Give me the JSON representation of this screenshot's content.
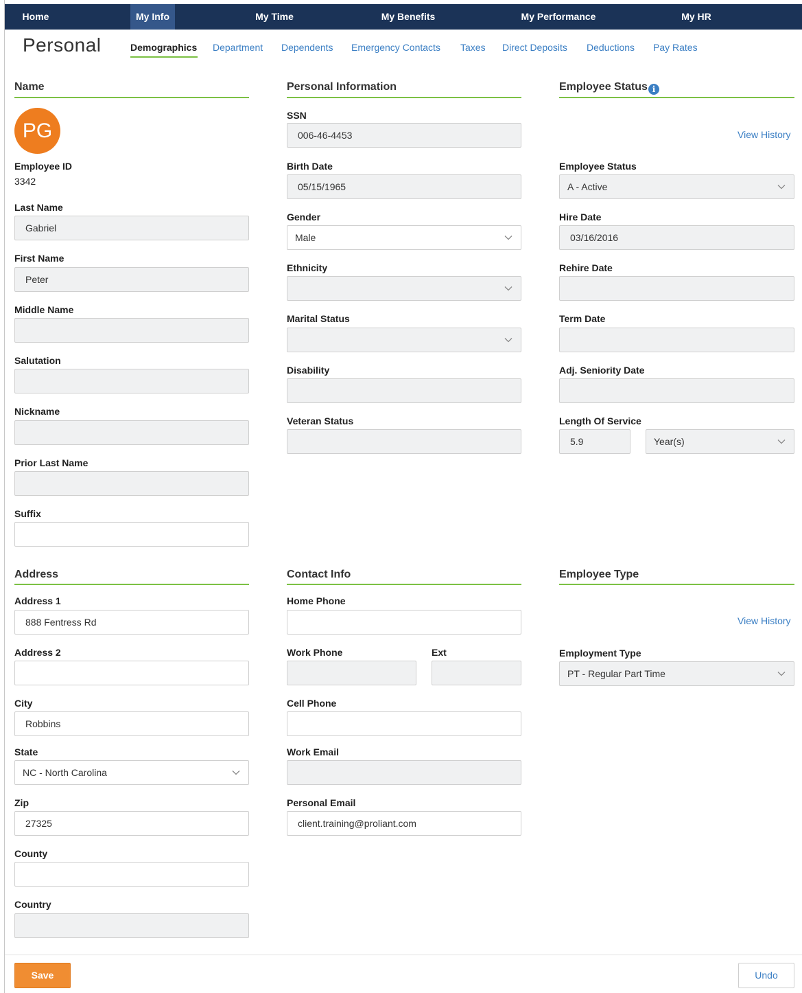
{
  "nav": {
    "items": [
      "Home",
      "My Info",
      "My Time",
      "My Benefits",
      "My Performance",
      "My HR"
    ],
    "active": "My Info"
  },
  "page_title": "Personal",
  "subtabs": [
    "Demographics",
    "Department",
    "Dependents",
    "Emergency Contacts",
    "Taxes",
    "Direct Deposits",
    "Deductions",
    "Pay Rates"
  ],
  "active_subtab": "Demographics",
  "name_section": {
    "title": "Name",
    "avatar_initials": "PG",
    "employee_id_label": "Employee ID",
    "employee_id": "3342",
    "last_name_label": "Last Name",
    "last_name": "Gabriel",
    "first_name_label": "First Name",
    "first_name": "Peter",
    "middle_name_label": "Middle Name",
    "middle_name": "",
    "salutation_label": "Salutation",
    "salutation": "",
    "nickname_label": "Nickname",
    "nickname": "",
    "prior_last_name_label": "Prior Last Name",
    "prior_last_name": "",
    "suffix_label": "Suffix",
    "suffix": ""
  },
  "personal_info": {
    "title": "Personal Information",
    "ssn_label": "SSN",
    "ssn": "006-46-4453",
    "birth_date_label": "Birth Date",
    "birth_date": "05/15/1965",
    "gender_label": "Gender",
    "gender": "Male",
    "ethnicity_label": "Ethnicity",
    "ethnicity": "",
    "marital_status_label": "Marital Status",
    "marital_status": "",
    "disability_label": "Disability",
    "disability": "",
    "veteran_status_label": "Veteran Status",
    "veteran_status": ""
  },
  "employee_status": {
    "title": "Employee Status",
    "view_history": "View History",
    "status_label": "Employee Status",
    "status": "A - Active",
    "hire_date_label": "Hire Date",
    "hire_date": "03/16/2016",
    "rehire_date_label": "Rehire Date",
    "rehire_date": "",
    "term_date_label": "Term Date",
    "term_date": "",
    "adj_seniority_label": "Adj. Seniority Date",
    "adj_seniority": "",
    "length_of_service_label": "Length Of Service",
    "length_of_service": "5.9",
    "length_unit": "Year(s)"
  },
  "address": {
    "title": "Address",
    "address1_label": "Address 1",
    "address1": "888 Fentress Rd",
    "address2_label": "Address 2",
    "address2": "",
    "city_label": "City",
    "city": "Robbins",
    "state_label": "State",
    "state": "NC - North Carolina",
    "zip_label": "Zip",
    "zip": "27325",
    "county_label": "County",
    "county": "",
    "country_label": "Country",
    "country": ""
  },
  "contact": {
    "title": "Contact Info",
    "home_phone_label": "Home Phone",
    "home_phone": "",
    "work_phone_label": "Work Phone",
    "work_phone": "",
    "ext_label": "Ext",
    "ext": "",
    "cell_phone_label": "Cell Phone",
    "cell_phone": "",
    "work_email_label": "Work Email",
    "work_email": "",
    "personal_email_label": "Personal Email",
    "personal_email": "client.training@proliant.com"
  },
  "employee_type": {
    "title": "Employee Type",
    "view_history": "View History",
    "employment_type_label": "Employment Type",
    "employment_type": "PT - Regular Part Time"
  },
  "footer": {
    "save": "Save",
    "undo": "Undo"
  },
  "colors": {
    "nav_bg": "#1b3357",
    "nav_active": "#35578a",
    "accent_green": "#7cc144",
    "link_blue": "#3b7fc4",
    "avatar_orange": "#ee7d1f",
    "save_orange": "#f08d32"
  }
}
